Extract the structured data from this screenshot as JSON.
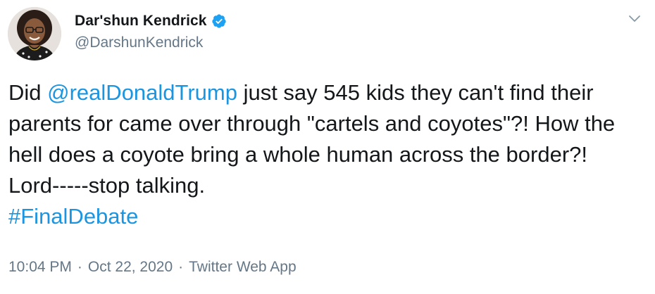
{
  "author": {
    "display_name": "Dar'shun Kendrick",
    "handle": "@DarshunKendrick",
    "verified": true,
    "verified_icon": "verified-badge-icon",
    "verified_color": "#1da1f2"
  },
  "menu": {
    "icon": "chevron-down-icon"
  },
  "tweet": {
    "segments": {
      "s1": "Did ",
      "mention": "@realDonaldTrump",
      "s2": " just say 545 kids they can't find their parents for came over through \"cartels and coyotes\"?! How the hell does a coyote bring a whole human across the border?!  Lord-----stop talking.",
      "hashtag": "#FinalDebate"
    },
    "link_color": "#1b95e0"
  },
  "meta": {
    "time": "10:04 PM",
    "separator": "·",
    "date": "Oct 22, 2020",
    "source": "Twitter Web App"
  }
}
